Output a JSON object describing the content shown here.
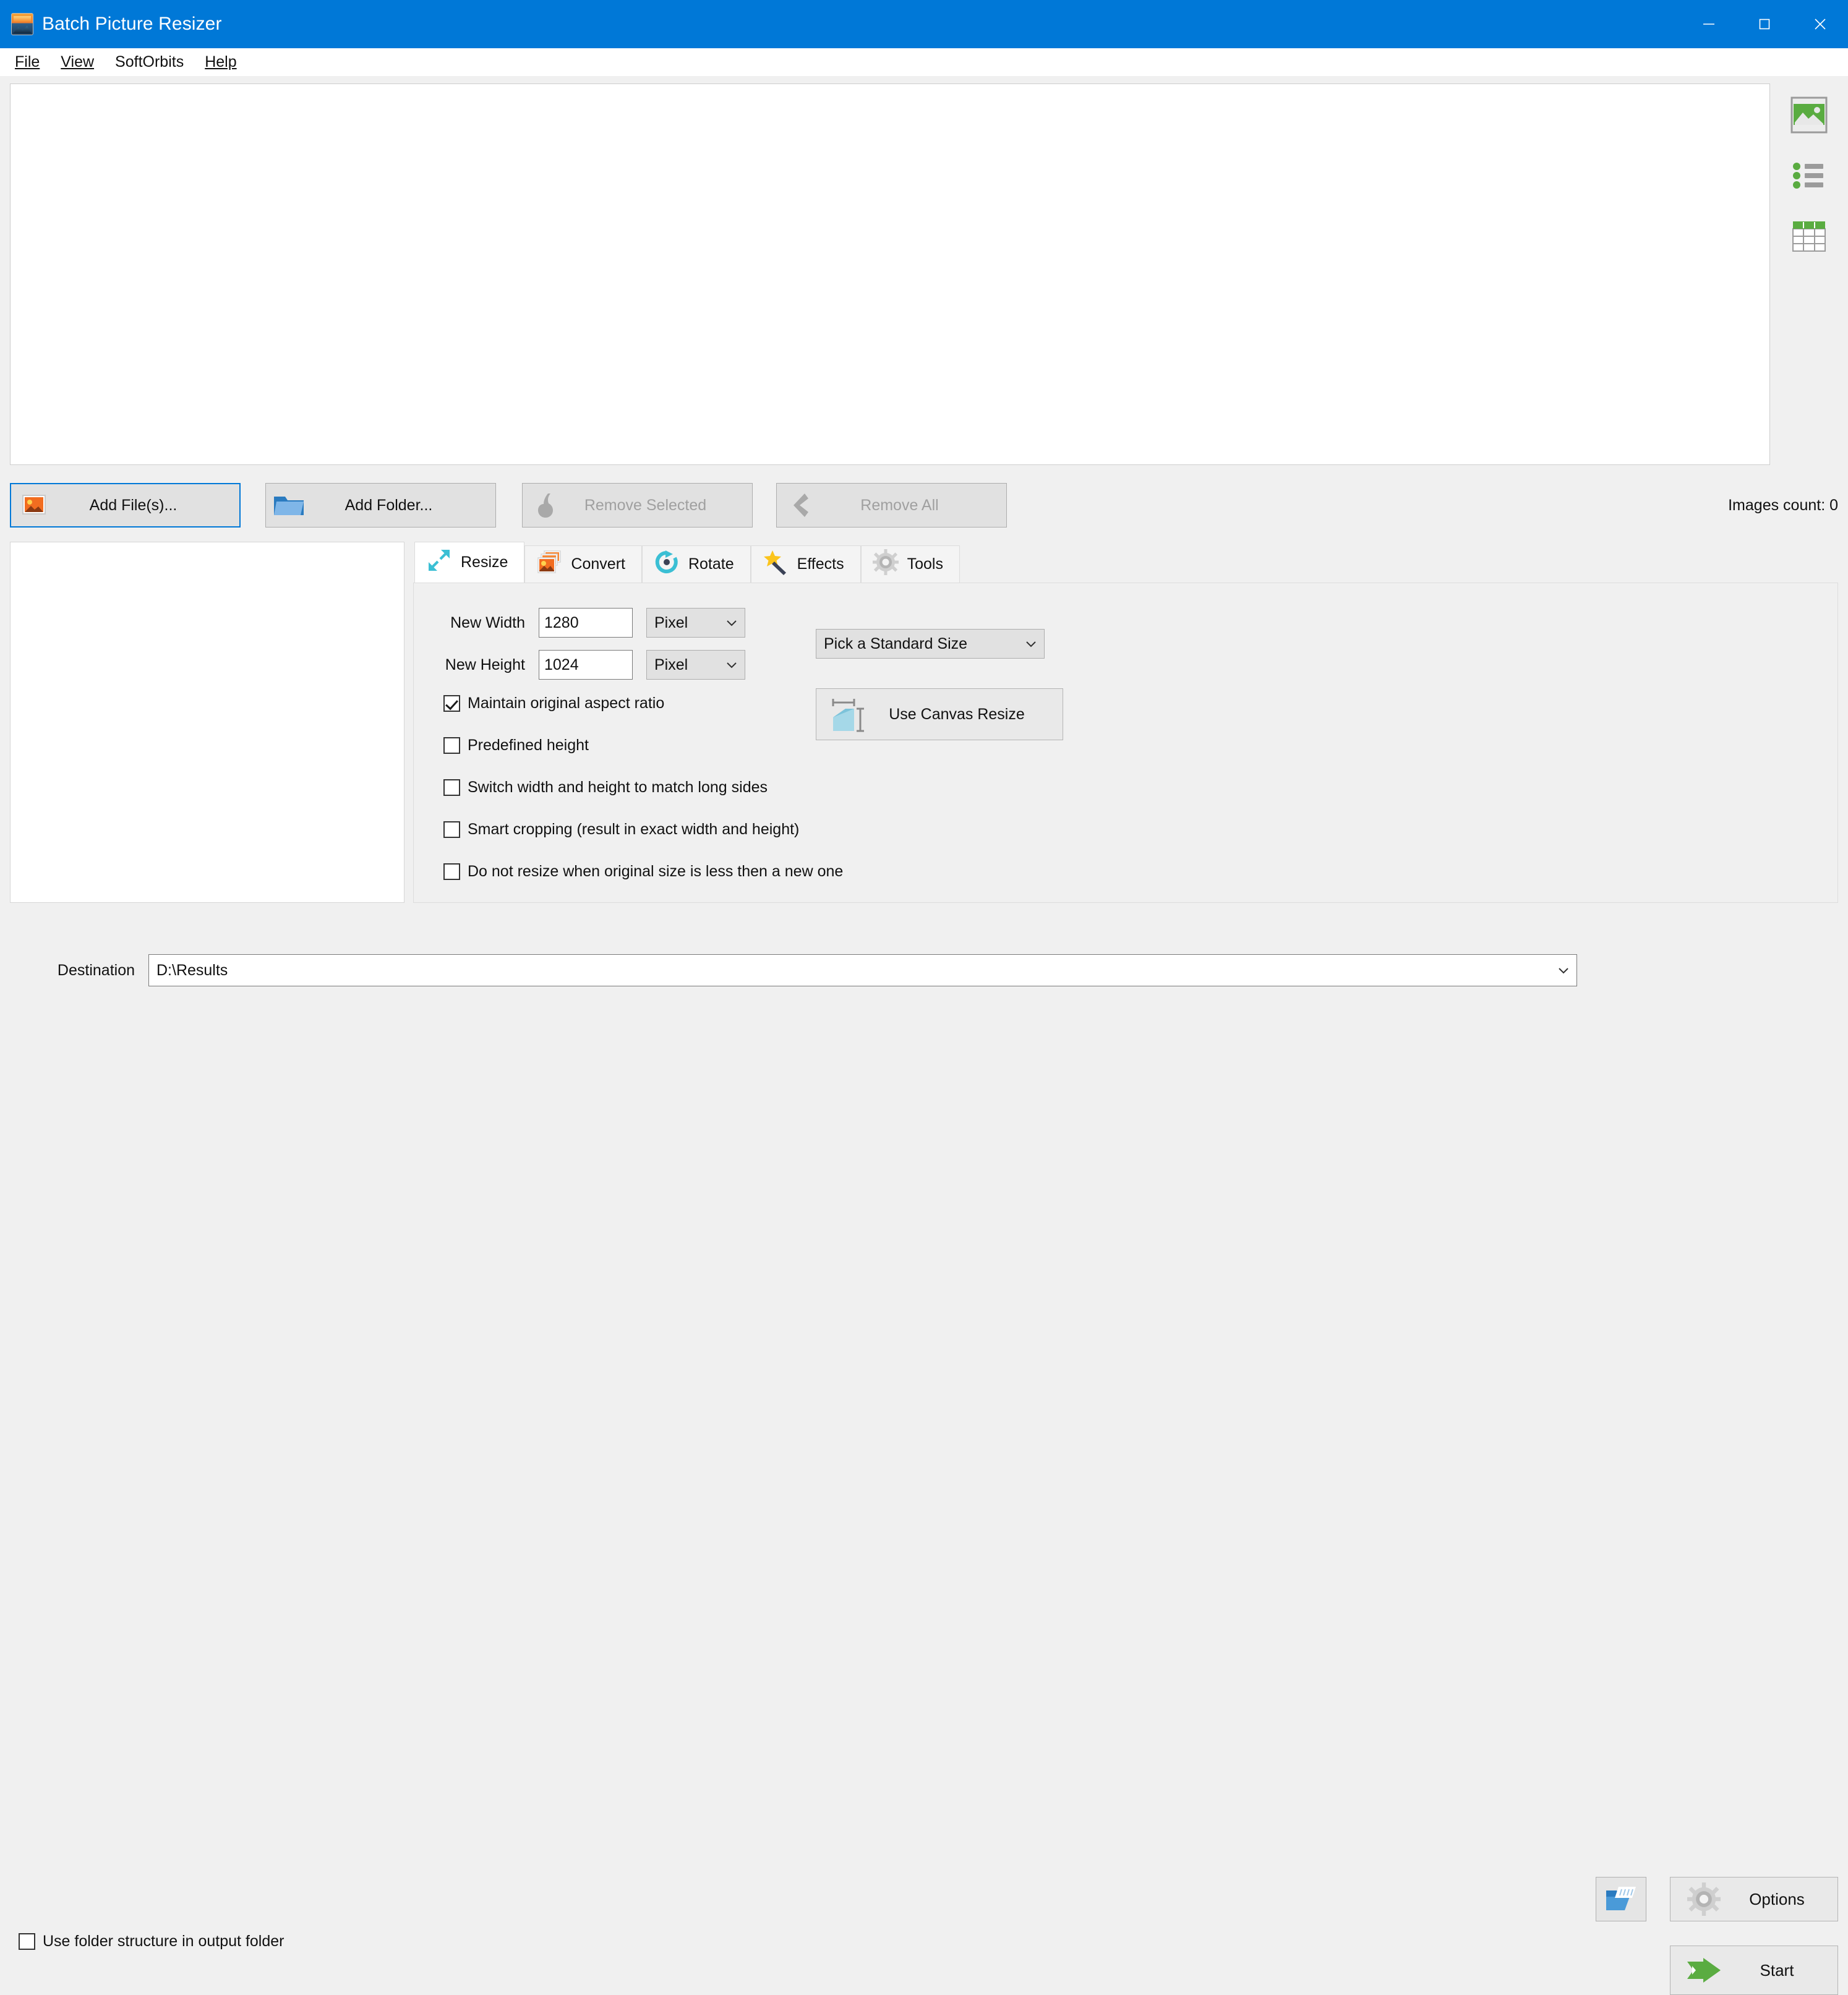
{
  "window": {
    "title": "Batch Picture Resizer",
    "icon": "app-picture-icon",
    "controls": {
      "minimize": "minimize-icon",
      "maximize": "maximize-icon",
      "close": "close-icon"
    }
  },
  "menubar": {
    "items": [
      {
        "label": "File",
        "accel": "F"
      },
      {
        "label": "View",
        "accel": "V"
      },
      {
        "label": "SoftOrbits",
        "accel": ""
      },
      {
        "label": "Help",
        "accel": "H"
      }
    ]
  },
  "viewbar": {
    "buttons": [
      {
        "name": "thumbnail-view-button",
        "icon": "image-thumbnail-icon"
      },
      {
        "name": "list-view-button",
        "icon": "bullet-list-icon"
      },
      {
        "name": "details-view-button",
        "icon": "table-grid-icon"
      }
    ]
  },
  "filelist": {
    "items": [],
    "images_count_label": "Images count: 0"
  },
  "toolbar": {
    "add_files": "Add File(s)...",
    "add_folder": "Add Folder...",
    "remove_selected": "Remove Selected",
    "remove_all": "Remove All"
  },
  "tabs": [
    {
      "label": "Resize",
      "icon": "resize-arrows-icon",
      "active": true
    },
    {
      "label": "Convert",
      "icon": "convert-images-icon",
      "active": false
    },
    {
      "label": "Rotate",
      "icon": "rotate-circular-arrow-icon",
      "active": false
    },
    {
      "label": "Effects",
      "icon": "magic-wand-icon",
      "active": false
    },
    {
      "label": "Tools",
      "icon": "gear-icon",
      "active": false
    }
  ],
  "resize": {
    "new_width_label": "New Width",
    "new_width_value": "1280",
    "new_width_unit": "Pixel",
    "new_height_label": "New Height",
    "new_height_value": "1024",
    "new_height_unit": "Pixel",
    "standard_size": "Pick a Standard Size",
    "canvas_resize_label": "Use Canvas Resize",
    "checkboxes": [
      {
        "label": "Maintain original aspect ratio",
        "checked": true
      },
      {
        "label": "Predefined height",
        "checked": false
      },
      {
        "label": "Switch width and height to match long sides",
        "checked": false
      },
      {
        "label": "Smart cropping (result in exact width and height)",
        "checked": false
      },
      {
        "label": "Do not resize when original size is less then a new one",
        "checked": false
      }
    ]
  },
  "bottom": {
    "destination_label": "Destination",
    "destination_value": "D:\\Results",
    "browse_icon": "open-folder-icon",
    "use_folder_structure_label": "Use folder structure in output folder",
    "use_folder_structure_checked": false,
    "options_label": "Options",
    "start_label": "Start"
  },
  "colors": {
    "titlebar": "#0078d7",
    "accent_teal": "#3bbfd4",
    "accent_green": "#5aac41",
    "accent_orange": "#f07c2c",
    "focus_blue": "#0078d7",
    "window_bg": "#f0f0f0"
  }
}
